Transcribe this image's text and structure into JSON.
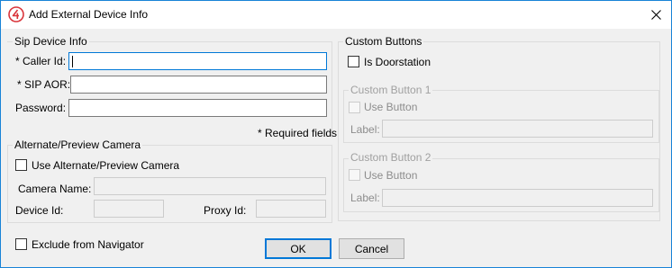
{
  "window": {
    "title": "Add External Device Info"
  },
  "sip_group": {
    "title": "Sip Device Info",
    "caller_id_label": "* Caller Id:",
    "caller_id_value": "",
    "sip_aor_label": "* SIP AOR:",
    "sip_aor_value": "",
    "password_label": "Password:",
    "password_value": ""
  },
  "required_note": "* Required fields",
  "camera_group": {
    "title": "Alternate/Preview Camera",
    "use_camera_label": "Use Alternate/Preview Camera",
    "camera_name_label": "Camera Name:",
    "device_id_label": "Device Id:",
    "proxy_id_label": "Proxy Id:"
  },
  "exclude_label": "Exclude from Navigator",
  "custom_buttons": {
    "title": "Custom Buttons",
    "is_doorstation_label": "Is Doorstation",
    "button1": {
      "title": "Custom Button 1",
      "use_label": "Use Button",
      "label_label": "Label:"
    },
    "button2": {
      "title": "Custom Button 2",
      "use_label": "Use Button",
      "label_label": "Label:"
    }
  },
  "buttons": {
    "ok": "OK",
    "cancel": "Cancel"
  },
  "colors": {
    "accent": "#0078d7",
    "app_icon": "#d9343a"
  }
}
